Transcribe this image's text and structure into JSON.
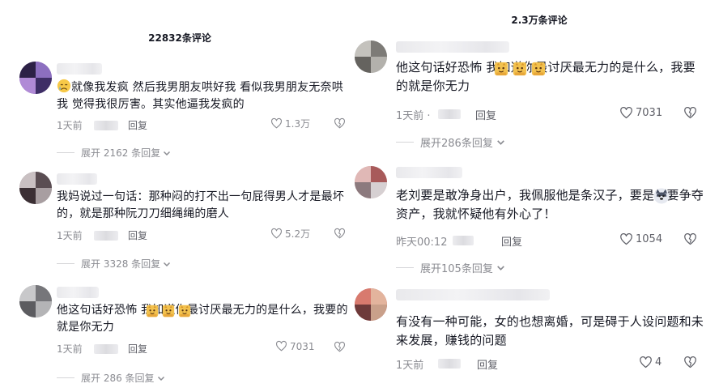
{
  "left": {
    "header": "22832条评论",
    "comments": [
      {
        "text": "就像我发疯 然后我男朋友哄好我 看似我男朋友无奈哄我 觉得我很厉害。其实他逼我发疯的",
        "time": "1天前",
        "reply": "回复",
        "likes": "1.3万",
        "expand": "展开 2162 条回复"
      },
      {
        "text": "我妈说过一句话：那种闷的打不出一句屁得男人才是最坏的，就是那种阮刀刀细绳绳的磨人",
        "time": "1天前",
        "reply": "回复",
        "likes": "5.2万",
        "expand": "展开 3328 条回复"
      },
      {
        "text": "他这句话好恐怖 我知道你最讨厌最无力的是什么，我要的就是你无力",
        "time": "1天前",
        "reply": "回复",
        "likes": "7031",
        "expand": "展开 286 条回复"
      }
    ]
  },
  "right": {
    "header": "2.3万条评论",
    "comments": [
      {
        "text": "他这句话好恐怖 我知道你最讨厌最无力的是什么，我要的就是你无力",
        "time": "1天前 ·",
        "reply": "回复",
        "likes": "7031",
        "expand": "展开286条回复"
      },
      {
        "text": "老刘要是敢净身出户，我佩服他是条汉子，要是非要争夺资产，我就怀疑他有外心了！",
        "time": "昨天00:12",
        "reply": "回复",
        "likes": "1054",
        "expand": "展开105条回复"
      },
      {
        "text": "有没有一种可能，女的也想离婚，可是碍于人设问题和未来发展，赚钱的问题",
        "time": "1天前",
        "reply": "回复",
        "likes": "4",
        "expand": ""
      }
    ]
  },
  "icons": {
    "like": "heart-outline-icon",
    "dislike": "heart-broken-icon",
    "expand": "chevron-down-icon",
    "emoji": "cat-emoji-icon"
  }
}
